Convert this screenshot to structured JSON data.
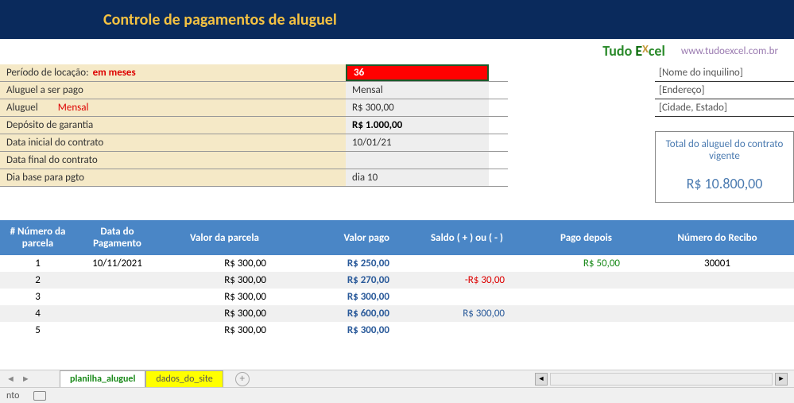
{
  "header": {
    "title": "Controle de pagamentos de aluguel"
  },
  "logo": {
    "tudo": "Tudo ",
    "e": "E",
    "x": "X",
    "cel": "cel",
    "url": "www.tudoexcel.com.br"
  },
  "form": {
    "rows": [
      {
        "label": "Período de locação:",
        "label_suffix": " em  meses",
        "value": "36",
        "red_cell": true,
        "suffix_red": true
      },
      {
        "label": "Aluguel a ser pago",
        "value": "Mensal"
      },
      {
        "label": "Aluguel",
        "label_suffix": "Mensal",
        "value": "R$ 300,00",
        "suffix_red2": true
      },
      {
        "label": "Depósito de garantia",
        "value": "R$ 1.000,00",
        "bold": true
      },
      {
        "label": "Data inicial do contrato",
        "value": "10/01/21"
      },
      {
        "label": "Data final do contrato",
        "value": ""
      },
      {
        "label": "Dia base para pgto",
        "value": "dia 10"
      }
    ]
  },
  "tenant": {
    "rows": [
      "[Nome do inquilino]",
      "[Endereço]",
      "[Cidade, Estado]"
    ]
  },
  "total": {
    "label": "Total do aluguel do contrato vigente",
    "value": "R$ 10.800,00"
  },
  "table": {
    "headers": [
      "# Número da parcela",
      "Data do Pagamento",
      "Valor da parcela",
      "Valor pago",
      "Saldo ( + ) ou ( - )",
      "Pago depois",
      "Número do Recibo"
    ],
    "rows": [
      {
        "n": "1",
        "data": "10/11/2021",
        "parcela": "R$ 300,00",
        "pago": "R$ 250,00",
        "saldo": "",
        "depois": "R$ 50,00",
        "recibo": "30001"
      },
      {
        "n": "2",
        "data": "",
        "parcela": "R$ 300,00",
        "pago": "R$ 270,00",
        "saldo": "-R$ 30,00",
        "saldo_neg": true,
        "depois": "",
        "recibo": ""
      },
      {
        "n": "3",
        "data": "",
        "parcela": "R$ 300,00",
        "pago": "R$ 300,00",
        "saldo": "",
        "depois": "",
        "recibo": ""
      },
      {
        "n": "4",
        "data": "",
        "parcela": "R$ 300,00",
        "pago": "R$ 600,00",
        "saldo": "R$ 300,00",
        "saldo_pos": true,
        "depois": "",
        "recibo": ""
      },
      {
        "n": "5",
        "data": "",
        "parcela": "R$ 300,00",
        "pago": "R$ 300,00",
        "saldo": "",
        "depois": "",
        "recibo": ""
      }
    ]
  },
  "tabs": {
    "active": "planilha_aluguel",
    "second": "dados_do_site"
  },
  "status": {
    "text": "nto"
  }
}
